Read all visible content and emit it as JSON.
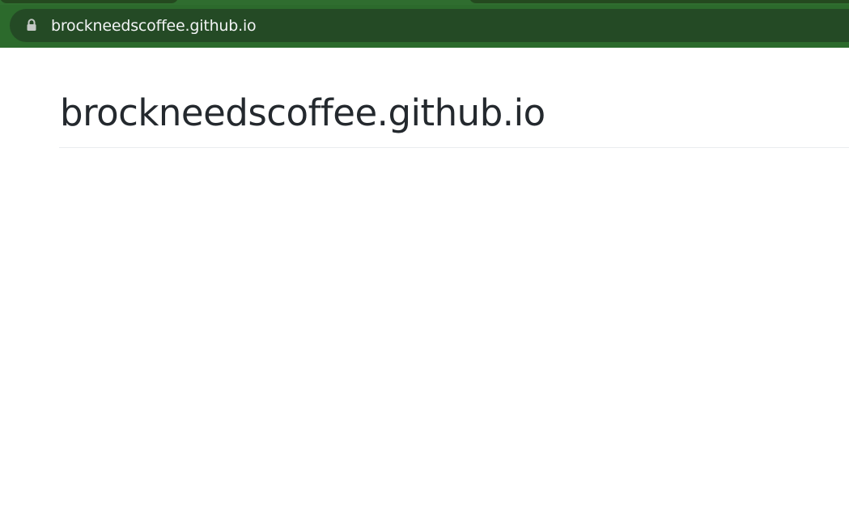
{
  "browser": {
    "url": "brockneedscoffee.github.io",
    "lock_icon": "lock-icon",
    "colors": {
      "chrome": "#2c6a2c",
      "omnibox": "#244a25",
      "url_text": "#f1f3f4"
    }
  },
  "page": {
    "title": "brockneedscoffee.github.io",
    "colors": {
      "title_text": "#24292e",
      "rule": "#eaecef"
    }
  }
}
